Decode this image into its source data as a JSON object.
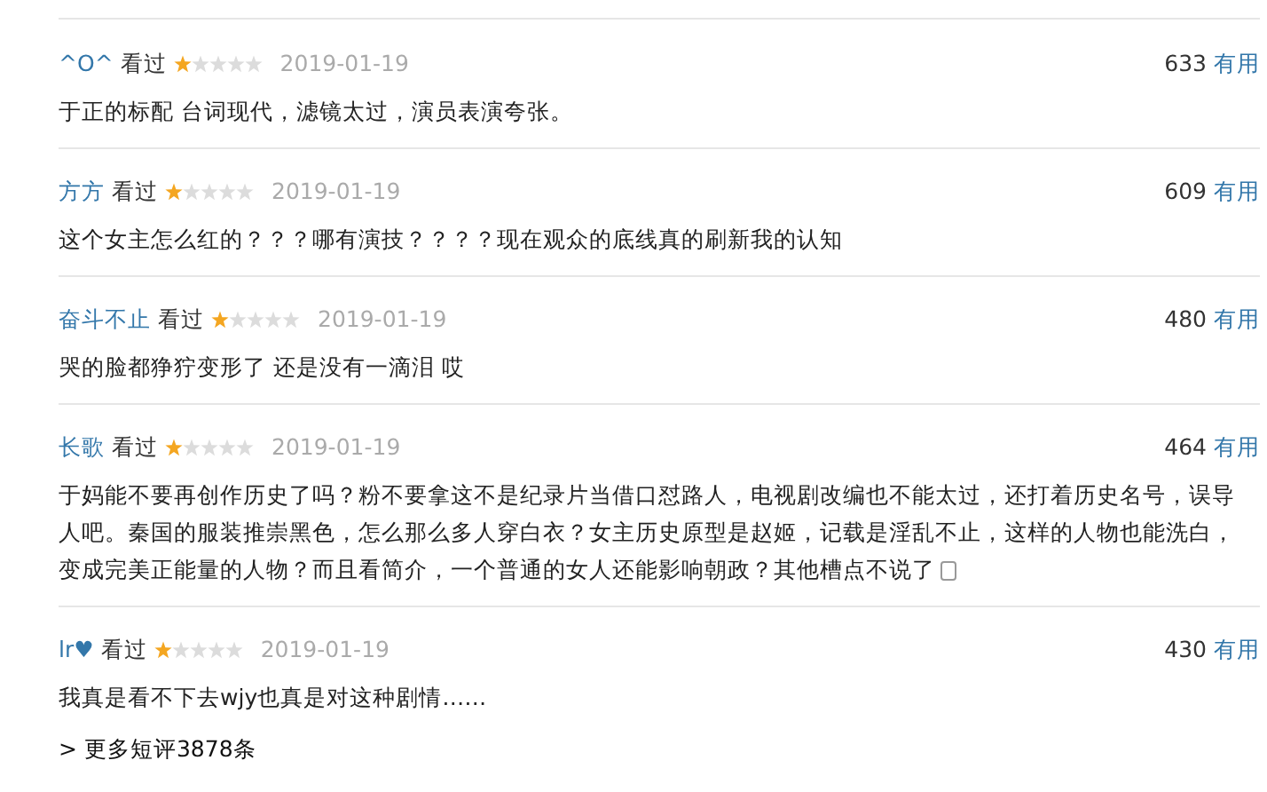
{
  "comments": [
    {
      "user": "^O^",
      "status": "看过",
      "stars": 1,
      "date": "2019-01-19",
      "votes": "633",
      "useful": "有用",
      "text": "于正的标配 台词现代，滤镜太过，演员表演夸张。",
      "emoji": false
    },
    {
      "user": "方方",
      "status": "看过",
      "stars": 1,
      "date": "2019-01-19",
      "votes": "609",
      "useful": "有用",
      "text": "这个女主怎么红的？？？哪有演技？？？？现在观众的底线真的刷新我的认知",
      "emoji": false
    },
    {
      "user": "奋斗不止",
      "status": "看过",
      "stars": 1,
      "date": "2019-01-19",
      "votes": "480",
      "useful": "有用",
      "text": "哭的脸都狰狞变形了 还是没有一滴泪 哎",
      "emoji": false
    },
    {
      "user": "长歌",
      "status": "看过",
      "stars": 1,
      "date": "2019-01-19",
      "votes": "464",
      "useful": "有用",
      "text": "于妈能不要再创作历史了吗？粉不要拿这不是纪录片当借口怼路人，电视剧改编也不能太过，还打着历史名号，误导人吧。秦国的服装推崇黑色，怎么那么多人穿白衣？女主历史原型是赵姬，记载是淫乱不止，这样的人物也能洗白，变成完美正能量的人物？而且看简介，一个普通的女人还能影响朝政？其他槽点不说了",
      "emoji": true
    },
    {
      "user": "lr♥",
      "status": "看过",
      "stars": 1,
      "date": "2019-01-19",
      "votes": "430",
      "useful": "有用",
      "text": "我真是看不下去wjy也真是对这种剧情……",
      "emoji": false
    }
  ],
  "more_link": {
    "arrow": ">",
    "label": "更多短评3878条"
  }
}
